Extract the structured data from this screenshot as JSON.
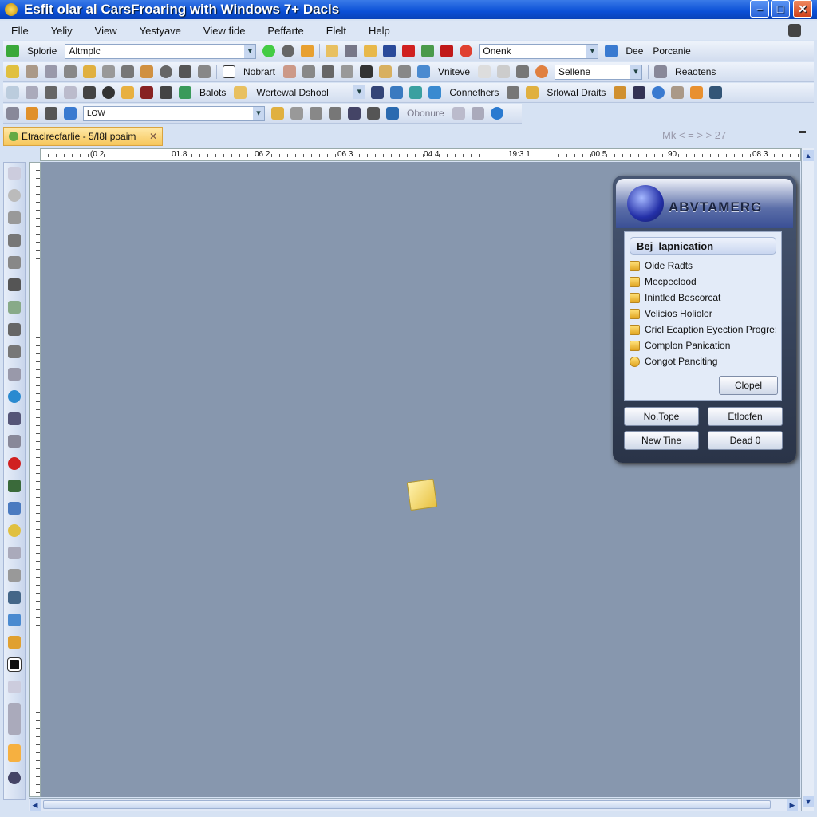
{
  "window": {
    "title": "Esfit olar al CarsFroaring with Windows 7+ Dacls"
  },
  "menu": [
    "Elle",
    "Yeliy",
    "View",
    "Yestyave",
    "View fide",
    "Peffarte",
    "Elelt",
    "Help"
  ],
  "toolbar1": {
    "button": "Splorie",
    "combo": "Altmplc",
    "combo2": "Onenk",
    "button2": "Dee",
    "button3": "Porcanie"
  },
  "toolbar2": {
    "button": "Nobrart",
    "label": "Vniteve",
    "combo": "Sellene",
    "label2": "Reaotens"
  },
  "toolbar3": {
    "label": "Balots",
    "combo": "Wertewal Dshool",
    "button": "Connethers",
    "button2": "Srlowal Draits"
  },
  "toolbar4": {
    "combo": "LOW",
    "label": "Obonure"
  },
  "doc_tab": {
    "label": "Etraclrecfarlie - 5/I8I poaim"
  },
  "nav_readout": "Mk < = > > 27",
  "ruler": [
    "(0 2",
    "01.8",
    "06 2",
    "06 3",
    "04 4",
    "19:3 1",
    "00 5",
    "90",
    "08 3"
  ],
  "panel": {
    "brand": "ABVTAMERG",
    "section_title": "Bej_lapnication",
    "items": [
      "Oide Radts",
      "Mecpeclood",
      "Inintled Bescorcat",
      "Velicios Holiolor",
      "Cricl Ecaption Eyection Progre:",
      "Complon Panication",
      "Congot Panciting"
    ],
    "close_button": "Clopel",
    "buttons": [
      "No.Tope",
      "Etlocfen",
      "New Tine",
      "Dead 0"
    ]
  },
  "colors": {
    "canvas": "#8797ae",
    "titlebar": "#0a4fd6",
    "tab": "#f6c65a"
  }
}
